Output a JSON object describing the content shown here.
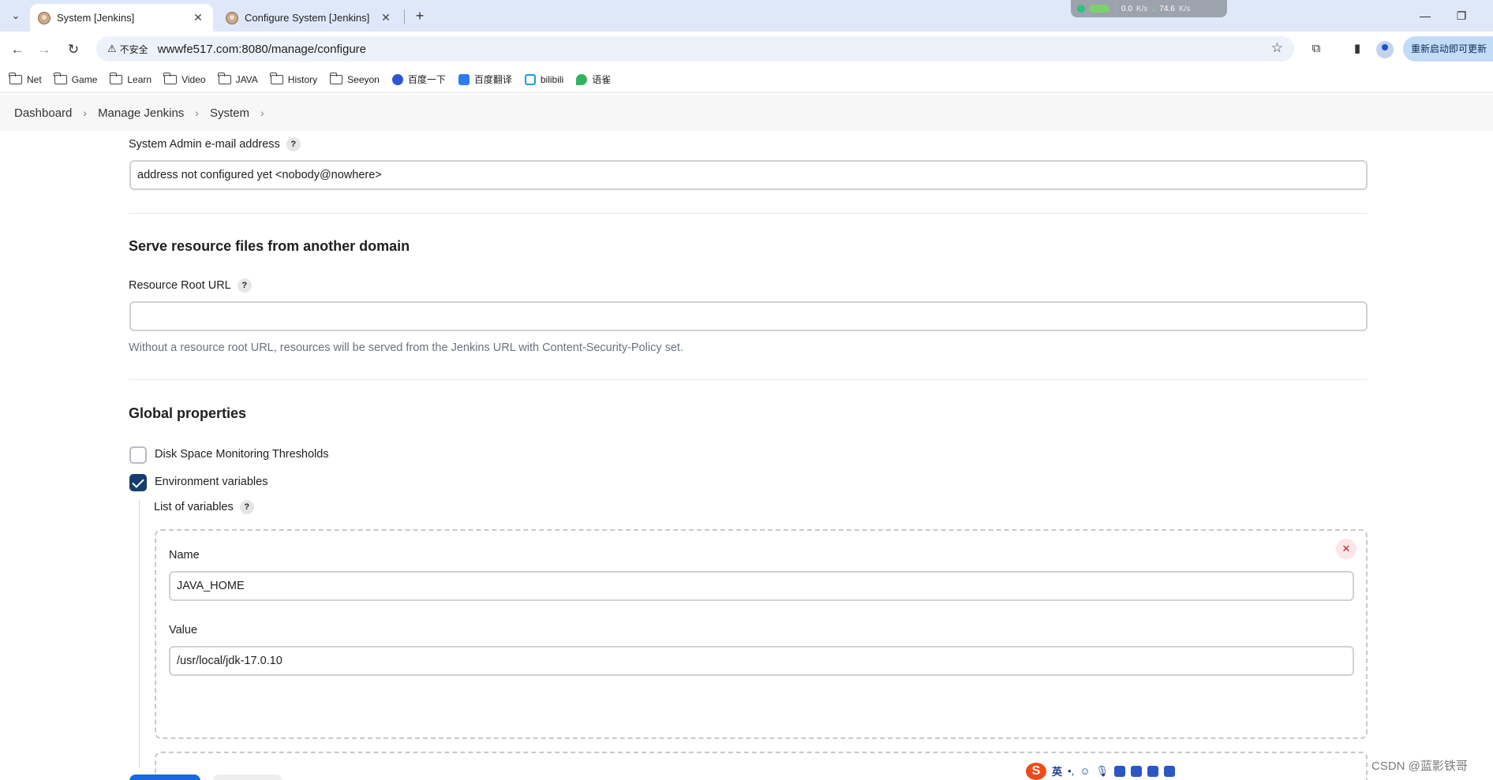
{
  "browser": {
    "tabs": [
      {
        "title": "System [Jenkins]",
        "active": true
      },
      {
        "title": "Configure System [Jenkins]",
        "active": false
      }
    ],
    "net_widget": {
      "up": "0.0",
      "up_unit": "K/s",
      "down": "74.6",
      "down_unit": "K/s"
    },
    "security_label": "不安全",
    "url": "wwwfe517.com:8080/manage/configure",
    "update_button": "重新启动即可更新"
  },
  "bookmarks": [
    {
      "label": "Net",
      "icon": "folder-icon"
    },
    {
      "label": "Game",
      "icon": "folder-icon"
    },
    {
      "label": "Learn",
      "icon": "folder-icon"
    },
    {
      "label": "Video",
      "icon": "folder-icon"
    },
    {
      "label": "JAVA",
      "icon": "folder-icon"
    },
    {
      "label": "History",
      "icon": "folder-icon"
    },
    {
      "label": "Seeyon",
      "icon": "folder-icon"
    },
    {
      "label": "百度一下",
      "icon": "baidu-icon"
    },
    {
      "label": "百度翻译",
      "icon": "translate-icon"
    },
    {
      "label": "bilibili",
      "icon": "bilibili-icon"
    },
    {
      "label": "语雀",
      "icon": "yuque-icon"
    }
  ],
  "breadcrumb": [
    "Dashboard",
    "Manage Jenkins",
    "System"
  ],
  "form": {
    "admin_email_label": "System Admin e-mail address",
    "admin_email_value": "address not configured yet <nobody@nowhere>",
    "resource_section_title": "Serve resource files from another domain",
    "resource_root_label": "Resource Root URL",
    "resource_root_value": "",
    "resource_root_desc": "Without a resource root URL, resources will be served from the Jenkins URL with Content-Security-Policy set.",
    "global_section_title": "Global properties",
    "disk_space_label": "Disk Space Monitoring Thresholds",
    "disk_space_checked": false,
    "env_vars_label": "Environment variables",
    "env_vars_checked": true,
    "list_label": "List of variables",
    "variables": [
      {
        "name_label": "Name",
        "name_value": "JAVA_HOME",
        "value_label": "Value",
        "value_value": "/usr/local/jdk-17.0.10"
      }
    ]
  },
  "ime": {
    "mode": "英"
  },
  "watermark": "CSDN @蓝影铁哥"
}
